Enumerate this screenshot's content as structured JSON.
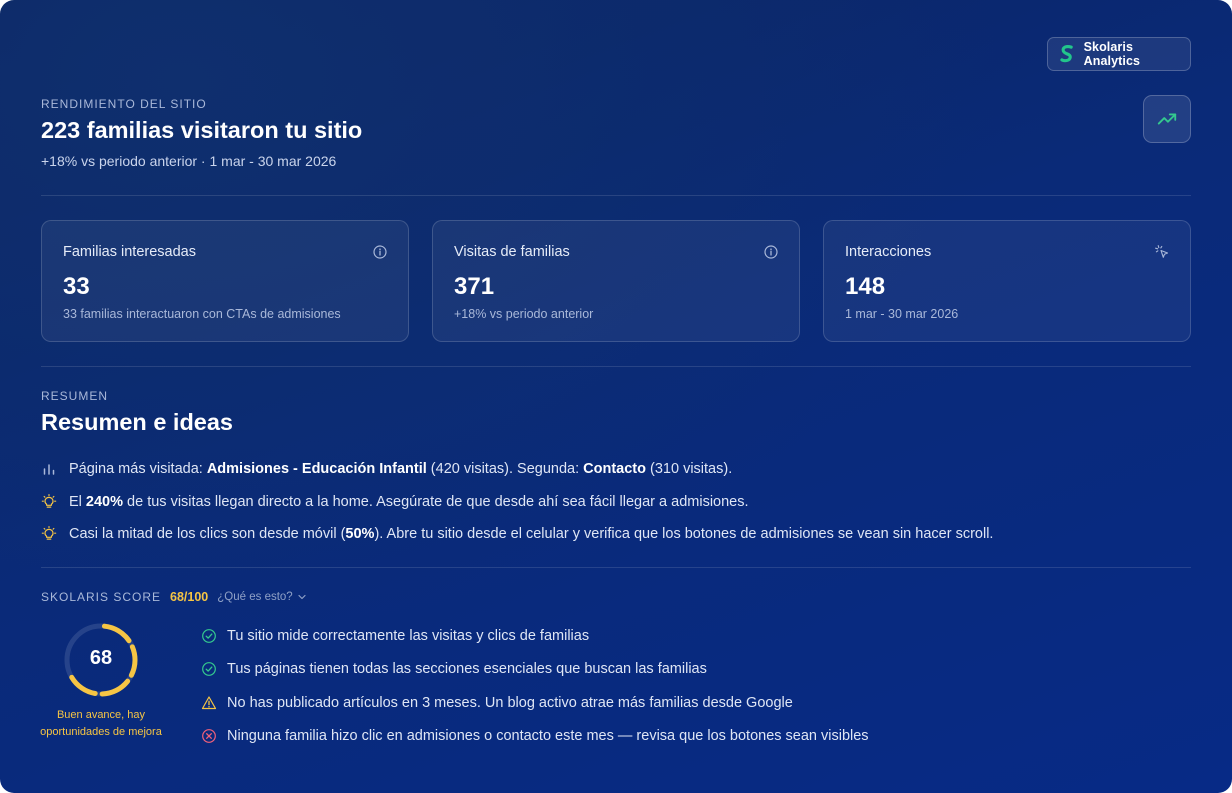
{
  "brand": {
    "name": "Skolaris Analytics"
  },
  "header": {
    "eyebrow": "RENDIMIENTO DEL SITIO",
    "title": "223 familias visitaron tu sitio",
    "subtitle": "+18% vs periodo anterior · 1 mar - 30 mar 2026"
  },
  "metrics": [
    {
      "label": "Familias interesadas",
      "value": "33",
      "note": "33 familias interactuaron con CTAs de admisiones",
      "icon": "info-icon"
    },
    {
      "label": "Visitas de familias",
      "value": "371",
      "note": "+18% vs periodo anterior",
      "icon": "info-icon"
    },
    {
      "label": "Interacciones",
      "value": "148",
      "note": "1 mar - 30 mar 2026",
      "icon": "cursor-click-icon"
    }
  ],
  "summary": {
    "eyebrow": "RESUMEN",
    "title": "Resumen e ideas",
    "insights": [
      {
        "icon": "bar-chart-icon",
        "p1": "Página más visitada: ",
        "b1": "Admisiones - Educación Infantil",
        "p2": " (420 visitas). Segunda: ",
        "b2": "Contacto",
        "p3": " (310 visitas)."
      },
      {
        "icon": "lightbulb-icon",
        "p1": "El ",
        "b1": "240%",
        "p2": " de tus visitas llegan directo a la home. Asegúrate de que desde ahí sea fácil llegar a admisiones.",
        "b2": "",
        "p3": ""
      },
      {
        "icon": "lightbulb-icon",
        "p1": "Casi la mitad de los clics son desde móvil (",
        "b1": "50%",
        "p2": "). Abre tu sitio desde el celular y verifica que los botones de admisiones se vean sin hacer scroll.",
        "b2": "",
        "p3": ""
      }
    ]
  },
  "score": {
    "label": "SKOLARIS SCORE",
    "value_text": "68/100",
    "help": "¿Qué es esto?",
    "value": 68,
    "max": 100,
    "caption": "Buen avance, hay oportunidades de mejora",
    "checks": [
      {
        "status": "ok",
        "text": "Tu sitio mide correctamente las visitas y clics de familias"
      },
      {
        "status": "ok",
        "text": "Tus páginas tienen todas las secciones esenciales que buscan las familias"
      },
      {
        "status": "warning",
        "text": "No has publicado artículos en 3 meses. Un blog activo atrae más familias desde Google"
      },
      {
        "status": "error",
        "text": "Ninguna familia hizo clic en admisiones o contacto este mes — revisa que los botones sean visibles"
      }
    ]
  },
  "colors": {
    "accent": "#f6c544",
    "ok": "#34c98e",
    "warning": "#f6c544",
    "error": "#f0607a",
    "brand_green": "#22c58b"
  }
}
